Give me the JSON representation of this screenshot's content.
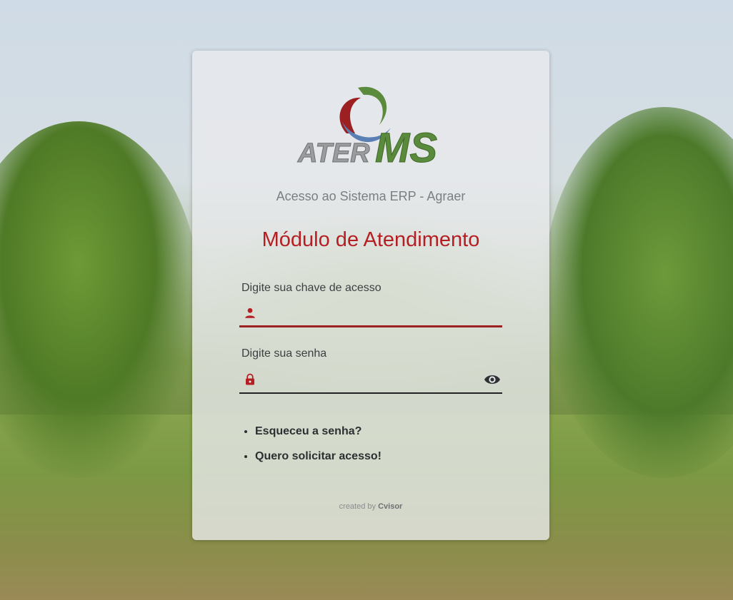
{
  "login": {
    "subtitle": "Acesso ao Sistema ERP - Agraer",
    "module_title": "Módulo de Atendimento",
    "key_label": "Digite sua chave de acesso",
    "key_value": "",
    "password_label": "Digite sua senha",
    "password_value": "",
    "forgot_password": "Esqueceu a senha?",
    "request_access": "Quero solicitar acesso!",
    "credit_prefix": "created by",
    "credit_brand": "Cvisor"
  },
  "logo": {
    "text_left": "ATER",
    "text_right": "MS"
  },
  "icons": {
    "user": "person-icon",
    "lock": "lock-icon",
    "visibility": "eye-icon"
  },
  "colors": {
    "accent_red": "#b51f24",
    "logo_green": "#5a8a3c",
    "logo_blue": "#5a7fb5",
    "logo_red": "#9c1f22"
  }
}
